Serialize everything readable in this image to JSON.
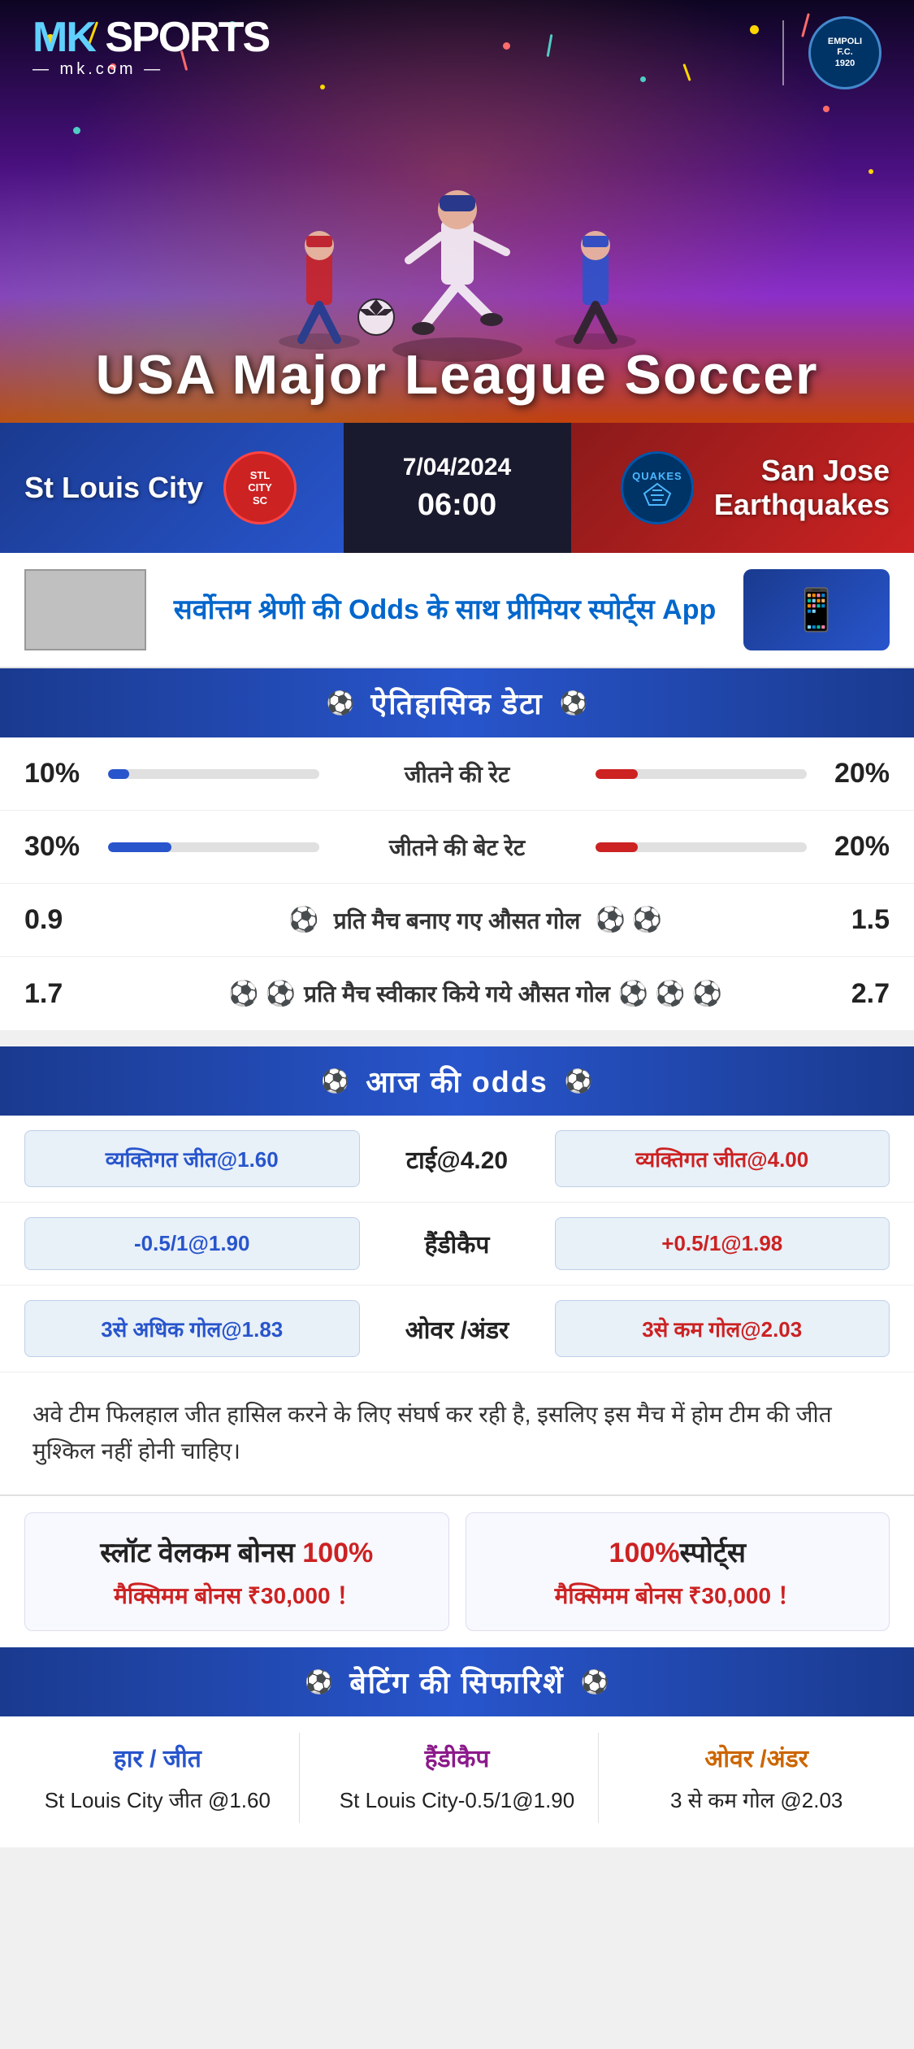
{
  "brand": {
    "name": "MK SPORTS",
    "sub": "mk.com",
    "partner": "EMPOLI F.C.",
    "partner_year": "1920"
  },
  "banner": {
    "title": "USA Major League Soccer"
  },
  "match": {
    "home_team": "St Louis City",
    "away_team": "San Jose Earthquakes",
    "away_team_line1": "San Jose",
    "away_team_line2": "Earthquakes",
    "date": "7/04/2024",
    "time": "06:00"
  },
  "promo": {
    "text_part1": "सर्वोत्तम श्रेणी की ",
    "text_highlight": "Odds",
    "text_part2": " के साथ प्रीमियर स्पोर्ट्स ",
    "text_part3": "App"
  },
  "historical": {
    "header": "ऐतिहासिक डेटा",
    "rows": [
      {
        "label": "जीतने की रेट",
        "left_val": "10%",
        "right_val": "20%",
        "left_pct": 10,
        "right_pct": 20,
        "type": "bar"
      },
      {
        "label": "जीतने की बेट रेट",
        "left_val": "30%",
        "right_val": "20%",
        "left_pct": 30,
        "right_pct": 20,
        "type": "bar"
      },
      {
        "label": "प्रति मैच बनाए गए औसत गोल",
        "left_val": "0.9",
        "right_val": "1.5",
        "left_icons": 1,
        "right_icons": 2,
        "type": "icon"
      },
      {
        "label": "प्रति मैच स्वीकार किये गये औसत गोल",
        "left_val": "1.7",
        "right_val": "2.7",
        "left_icons": 2,
        "right_icons": 3,
        "type": "icon"
      }
    ]
  },
  "odds": {
    "header": "आज की odds",
    "rows": [
      {
        "left_label": "व्यक्तिगत जीत@1.60",
        "center_label": "टाई@4.20",
        "right_label": "व्यक्तिगत जीत@4.00",
        "right_red": true
      },
      {
        "left_label": "-0.5/1@1.90",
        "center_label": "हैंडीकैप",
        "right_label": "+0.5/1@1.98",
        "right_red": true
      },
      {
        "left_label": "3से अधिक गोल@1.83",
        "center_label": "ओवर /अंडर",
        "right_label": "3से कम गोल@2.03",
        "right_red": true
      }
    ]
  },
  "analysis": {
    "text": "अवे टीम फिलहाल जीत हासिल करने के लिए संघर्ष कर रही है, इसलिए इस मैच में होम टीम की जीत मुश्किल नहीं होनी चाहिए।"
  },
  "bonus": {
    "header": "",
    "cards": [
      {
        "title_part1": "स्लॉट वेलकम बोनस ",
        "title_highlight": "100%",
        "subtitle": "मैक्सिमम बोनस ₹30,000  ！"
      },
      {
        "title_highlight": "100%",
        "title_part2": "स्पोर्ट्स",
        "subtitle": "मैक्सिमम बोनस  ₹30,000 ！"
      }
    ]
  },
  "betting": {
    "header": "बेटिंग की सिफारिशें",
    "cols": [
      {
        "title": "हार / जीत",
        "color": "blue",
        "rec": "St Louis City जीत @1.60"
      },
      {
        "title": "हैंडीकैप",
        "color": "purple",
        "rec": "St Louis City-0.5/1@1.90"
      },
      {
        "title": "ओवर /अंडर",
        "color": "orange",
        "rec": "3 से कम गोल @2.03"
      }
    ]
  }
}
